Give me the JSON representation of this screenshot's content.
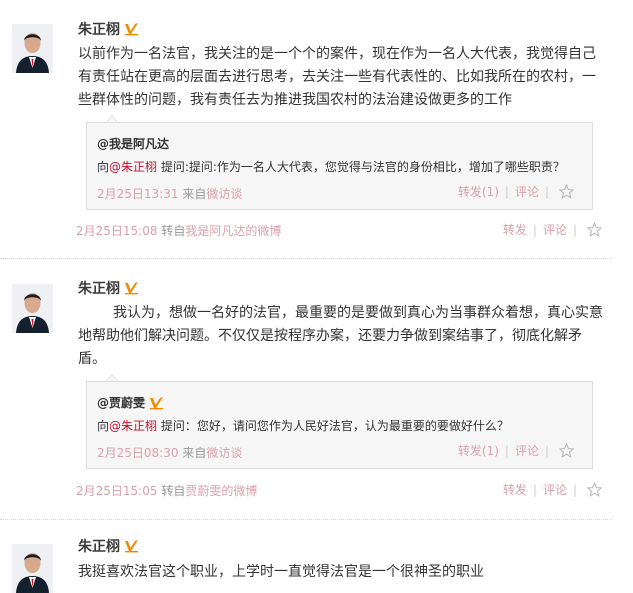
{
  "feed": {
    "posts": [
      {
        "author": "朱正栩",
        "content": "以前作为一名法官，我关注的是一个个的案件，现在作为一名人大代表，我觉得自己有责任站在更高的层面去进行思考，去关注一些有代表性的、比如我所在的农村，一些群体性的问题，我有责任去为推进我国农村的法治建设做更多的工作",
        "quote": {
          "author": "@我是阿凡达",
          "prefix": "向",
          "mention": "@朱正栩",
          "text": " 提问:提问:作为一名人大代表，您觉得与法官的身份相比，增加了哪些职责？",
          "time": "2月25日13:31",
          "source_prefix": "来自",
          "source": "微访谈",
          "repost": "转发(1)",
          "comment": "评论"
        },
        "time": "2月25日15:08",
        "source_prefix": "转自",
        "source": "我是阿凡达的微博",
        "repost": "转发",
        "comment": "评论"
      },
      {
        "author": "朱正栩",
        "content": "我认为，想做一名好的法官，最重要的是要做到真心为当事群众着想，真心实意地帮助他们解决问题。不仅仅是按程序办案，还要力争做到案结事了，彻底化解矛盾。",
        "quote": {
          "author": "@贾蔚雯",
          "prefix": "向",
          "mention": "@朱正栩",
          "text": " 提问：您好，请问您作为人民好法官，认为最重要的要做好什么？",
          "time": "2月25日08:30",
          "source_prefix": "来自",
          "source": "微访谈",
          "repost": "转发(1)",
          "comment": "评论"
        },
        "time": "2月25日15:05",
        "source_prefix": "转自",
        "source": "贾蔚雯的微博",
        "repost": "转发",
        "comment": "评论"
      },
      {
        "author": "朱正栩",
        "content": "我挺喜欢法官这个职业，上学时一直觉得法官是一个很神圣的职业"
      }
    ]
  },
  "colors": {
    "accent_red": "#c8102e",
    "link_pink": "#d9a0a8",
    "vip_orange": "#f08a00"
  },
  "icons": {
    "verified": "verified-v-icon",
    "favorite": "star-icon"
  }
}
